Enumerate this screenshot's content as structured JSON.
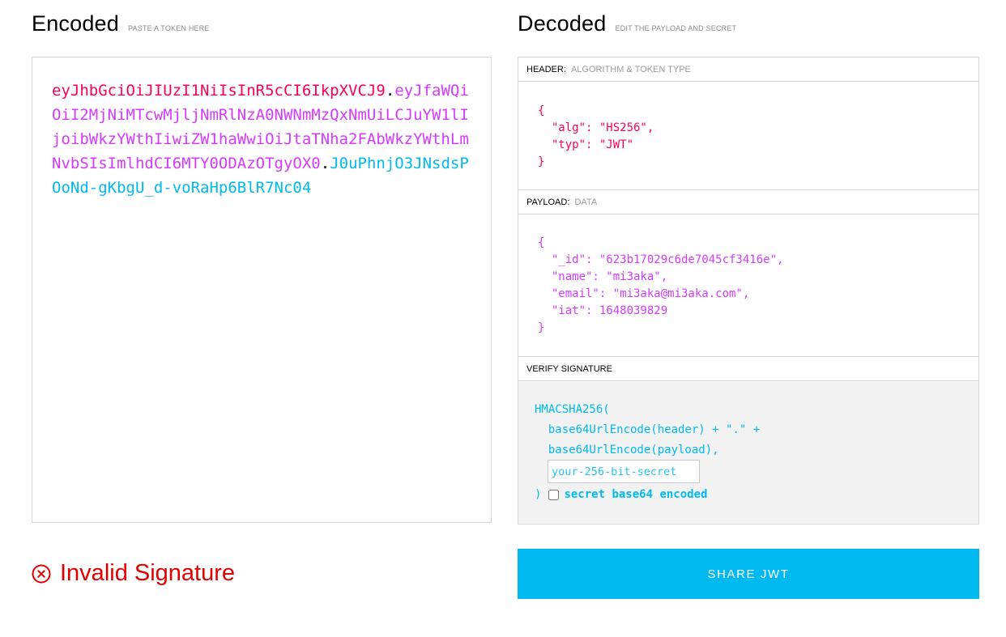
{
  "encoded": {
    "title": "Encoded",
    "hint": "PASTE A TOKEN HERE",
    "token_header": "eyJhbGciOiJIUzI1NiIsInR5cCI6IkpXVCJ9",
    "token_payload": "eyJfaWQiOiI2MjNiMTcwMjljNmRlNzA0NWNmMzQxNmUiLCJuYW1lIjoibWkzYWthIiwiZW1haWwiOiJtaTNha2FAbWkzYWthLmNvbSIsImlhdCI6MTY0ODAzOTgyOX0",
    "token_signature": "J0uPhnjO3JNsdsPOoNd-gKbgU_d-voRaHp6BlR7Nc04",
    "dot": "."
  },
  "decoded": {
    "title": "Decoded",
    "hint": "EDIT THE PAYLOAD AND SECRET",
    "header_section": {
      "title": "HEADER:",
      "subtitle": "ALGORITHM & TOKEN TYPE"
    },
    "header_json": "{\n  \"alg\": \"HS256\",\n  \"typ\": \"JWT\"\n}",
    "payload_section": {
      "title": "PAYLOAD:",
      "subtitle": "DATA"
    },
    "payload_json": "{\n  \"_id\": \"623b17029c6de7045cf3416e\",\n  \"name\": \"mi3aka\",\n  \"email\": \"mi3aka@mi3aka.com\",\n  \"iat\": 1648039829\n}",
    "verify_section": {
      "title": "VERIFY SIGNATURE"
    },
    "verify": {
      "line1": "HMACSHA256(",
      "line2": "  base64UrlEncode(header) + \".\" +",
      "line3": "  base64UrlEncode(payload),",
      "secret_placeholder": "your-256-bit-secret",
      "close": ")",
      "checkbox_label": "secret base64 encoded",
      "checkbox_checked": false
    }
  },
  "status": {
    "text": "Invalid Signature",
    "icon": "circle-x-icon",
    "color": "#e00000"
  },
  "share_button": {
    "label": "SHARE JWT",
    "color": "#00b9f1"
  },
  "colors": {
    "header": "#fb015b",
    "payload": "#d63aff",
    "signature": "#00b9f1"
  }
}
